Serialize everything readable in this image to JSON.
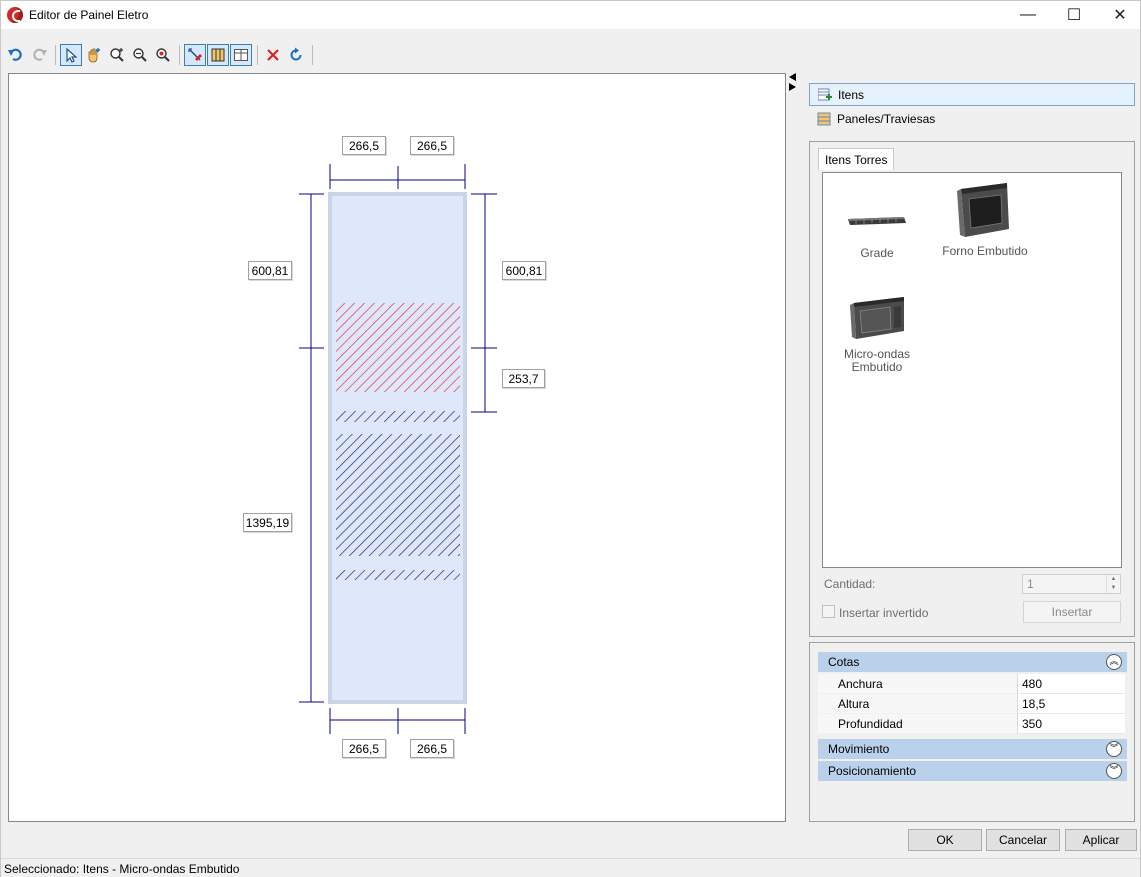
{
  "window": {
    "title": "Editor de Painel Eletro",
    "minimize": "—",
    "maximize": "☐",
    "close": "✕"
  },
  "toolbar": {
    "buttons": [
      "undo-icon",
      "redo-icon",
      "select-icon",
      "pan-icon",
      "zoom-fit-icon",
      "zoom-out-icon",
      "zoom-search-icon",
      "edit-pen-icon",
      "panel-icon",
      "grid-icon",
      "delete-icon",
      "refresh-icon"
    ]
  },
  "canvas": {
    "dimensions": {
      "top_left": "266,5",
      "top_right": "266,5",
      "bottom_left": "266,5",
      "bottom_right": "266,5",
      "left_upper": "600,81",
      "left_lower": "1395,19",
      "right_upper": "600,81",
      "right_lower": "253,7"
    },
    "colors": {
      "panel_fill": "#dfe8fb",
      "panel_border": "#c9d4e6",
      "dimension_line": "#00008b",
      "selected_hatch": "#e0334a",
      "item_hatch": "#1a2a78"
    }
  },
  "sidebar": {
    "nav": [
      {
        "label": "Itens",
        "icon": "items-icon",
        "selected": true
      },
      {
        "label": "Paneles/Traviesas",
        "icon": "panels-icon",
        "selected": false
      }
    ],
    "tab": "Itens Torres",
    "items": [
      {
        "label": "Grade"
      },
      {
        "label": "Forno Embutido"
      },
      {
        "label": "Micro-ondas Embutido"
      }
    ],
    "quantity_label": "Cantidad:",
    "quantity_value": "1",
    "invert_label": "Insertar invertido",
    "insert_button": "Insertar"
  },
  "properties": {
    "cotas_header": "Cotas",
    "rows": [
      {
        "name": "Anchura",
        "value": "480"
      },
      {
        "name": "Altura",
        "value": "18,5"
      },
      {
        "name": "Profundidad",
        "value": "350"
      }
    ],
    "movimiento_header": "Movimiento",
    "posicionamiento_header": "Posicionamiento"
  },
  "buttons": {
    "ok": "OK",
    "cancel": "Cancelar",
    "apply": "Aplicar"
  },
  "status": "Seleccionado: Itens - Micro-ondas Embutido"
}
